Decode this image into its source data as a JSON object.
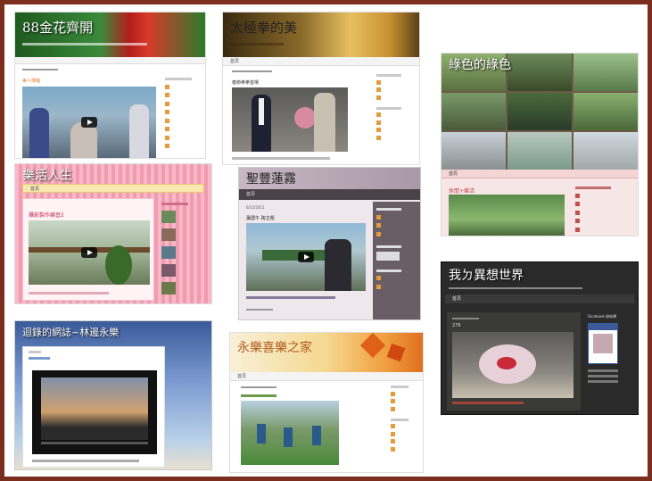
{
  "tiles": {
    "t1": {
      "title": "88金花齊開",
      "nav": "",
      "post_title": "美人傳唱"
    },
    "t2": {
      "title": "太極拳的美",
      "nav": "首頁",
      "post_title": "春節拳拳首場"
    },
    "t3": {
      "title": "綠色的綠色",
      "nav": "首頁",
      "post_title": "休閒+樂活"
    },
    "t4": {
      "title": "樂活人生",
      "nav": "首頁",
      "post_title": "攝影製作練習2"
    },
    "t5": {
      "title": "聖豐蓮霧",
      "nav": "首頁",
      "post_title": "瀰濃午 跨主題",
      "post_date": "6/15/2011"
    },
    "t6": {
      "title": "我ㄉ異想世界",
      "nav": "首頁",
      "sidebar_title": "Facebook 粉絲專",
      "count": "276"
    },
    "t7": {
      "title": "迴錄的網誌~林邊永樂",
      "nav": ""
    },
    "t8": {
      "title": "永樂喜樂之家",
      "nav": "首頁"
    }
  },
  "colors": {
    "border": "#7b2e1e",
    "t1_header": "#2a6b2a",
    "t3_header": "#6d5b47",
    "t4_header": "#f2a3b8",
    "t5_header": "#b8a8b4",
    "t6_bg": "#2a2a2a",
    "t7_bg": "#6d8ec4",
    "t8_header": "#f5c060"
  }
}
